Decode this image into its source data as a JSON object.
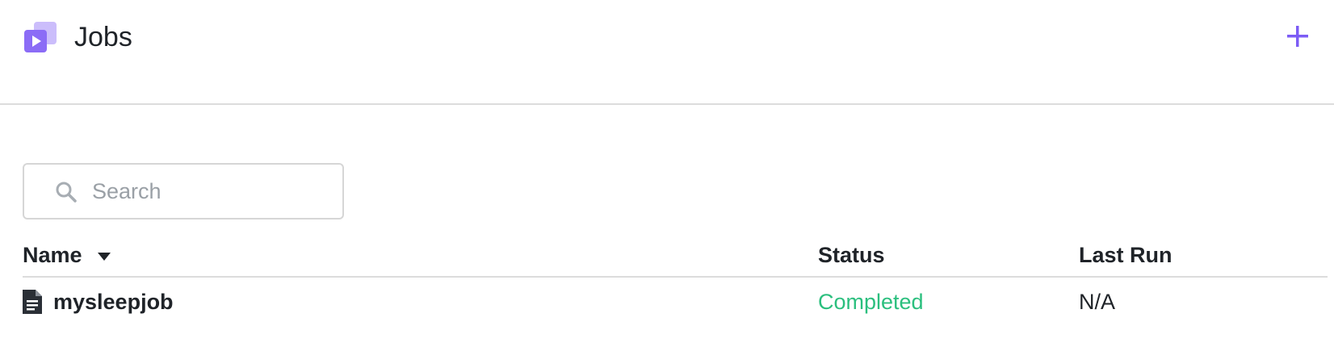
{
  "header": {
    "title": "Jobs",
    "app_icon": "jobs-play-icon",
    "add_icon": "plus-icon",
    "accent_color": "#7c5cf5"
  },
  "search": {
    "placeholder": "Search",
    "value": "",
    "icon": "search-icon"
  },
  "table": {
    "columns": {
      "name": "Name",
      "status": "Status",
      "last_run": "Last Run"
    },
    "sort": {
      "column": "name",
      "direction": "descending",
      "icon": "caret-down-icon"
    },
    "rows": [
      {
        "name": "mysleepjob",
        "icon": "file-icon",
        "status": "Completed",
        "status_color": "#2bbf7e",
        "last_run": "N/A"
      }
    ]
  }
}
